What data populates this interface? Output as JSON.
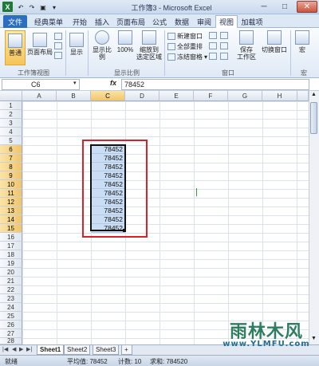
{
  "window": {
    "title": "工作簿3 - Microsoft Excel",
    "minimize": "─",
    "maximize": "□",
    "close": "✕"
  },
  "tabs": [
    {
      "label": "文件"
    },
    {
      "label": "经典菜单"
    },
    {
      "label": "开始"
    },
    {
      "label": "插入"
    },
    {
      "label": "页面布局"
    },
    {
      "label": "公式"
    },
    {
      "label": "数据"
    },
    {
      "label": "审阅"
    },
    {
      "label": "视图"
    },
    {
      "label": "加载项"
    }
  ],
  "ribbon": {
    "normal": "普通",
    "page_layout": "页面布局",
    "show": "显示",
    "zoom": "显示比例",
    "zoom100": "100%",
    "zoom_selection": "缩放到\n选定区域",
    "new_window": "新建窗口",
    "arrange_all": "全部重排",
    "freeze_panes": "冻结窗格",
    "save_workspace": "保存\n工作区",
    "switch_windows": "切换窗口",
    "macros": "宏",
    "group_workbook_views": "工作簿视图",
    "group_zoom": "显示比例",
    "group_window": "窗口",
    "group_macros": "宏"
  },
  "formula_bar": {
    "name_box": "C6",
    "fx": "fx",
    "value": "78452"
  },
  "columns": [
    "A",
    "B",
    "C",
    "D",
    "E",
    "F",
    "G",
    "H"
  ],
  "rows": [
    "1",
    "2",
    "3",
    "4",
    "5",
    "6",
    "7",
    "8",
    "9",
    "10",
    "11",
    "12",
    "13",
    "14",
    "15",
    "16",
    "17",
    "18",
    "19",
    "20",
    "21",
    "22",
    "23",
    "24",
    "25",
    "26",
    "27",
    "28"
  ],
  "cells": [
    "78452",
    "78452",
    "78452",
    "78452",
    "78452",
    "78452",
    "78452",
    "78452",
    "78452",
    "78452"
  ],
  "sheets": [
    "Sheet1",
    "Sheet2",
    "Sheet3"
  ],
  "status": {
    "mode": "就绪",
    "average": "平均值: 78452",
    "count": "计数: 10",
    "sum": "求和: 784520"
  },
  "watermark": {
    "text": "雨林木风",
    "url": "www.YLMFU.com"
  },
  "colors": {
    "selection_fill": "#c9ddf4",
    "annotation_red": "#d8222b",
    "file_tab": "#2a6fc0"
  }
}
